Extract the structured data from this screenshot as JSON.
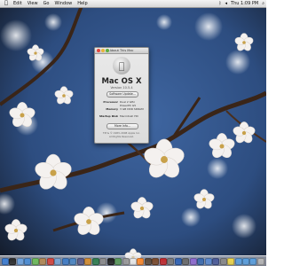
{
  "menubar": {
    "items": [
      "Edit",
      "View",
      "Go",
      "Window",
      "Help"
    ],
    "clock": "Thu 1:09 PM"
  },
  "about_window": {
    "title": "About This Mac",
    "os_name": "Mac OS X",
    "version": "Version 10.5.4",
    "software_update_label": "Software Update...",
    "rows": [
      {
        "label": "Processor",
        "value": "Dual 2 GHz PowerPC G5"
      },
      {
        "label": "Memory",
        "value": "3 GB DDR SDRAM"
      },
      {
        "label": "Startup Disk",
        "value": "Macintosh HD"
      }
    ],
    "more_info_label": "More Info...",
    "footer_line1": "TM & © 1983–2008 Apple Inc.",
    "footer_line2": "All Rights Reserved."
  },
  "colors": {
    "sky": "#2d4d80",
    "branch": "#3a2518",
    "blossom": "#f4f1ef",
    "blossom_center": "#c8a14a"
  },
  "dock": {
    "icons": [
      "finder-icon",
      "dashboard-icon",
      "mail-icon",
      "safari-icon",
      "ichat-icon",
      "address-book-icon",
      "ical-icon",
      "preview-icon",
      "itunes-icon",
      "iphoto-icon",
      "imovie-icon",
      "garageband-icon",
      "time-machine-icon",
      "system-preferences-icon",
      "terminal-icon",
      "activity-monitor-icon",
      "disk-utility-icon",
      "textedit-icon",
      "calculator-icon",
      "chess-icon",
      "dictionary-icon",
      "photo-booth-icon",
      "font-book-icon",
      "quicktime-icon",
      "image-capture-icon",
      "front-row-icon",
      "spaces-icon",
      "expose-icon",
      "grapher-icon",
      "console-icon",
      "stickies-icon",
      "downloads-icon",
      "documents-icon",
      "applications-icon",
      "trash-icon"
    ],
    "icon_colors": [
      "#3d7fd6",
      "#2b2b2b",
      "#6fa4e0",
      "#4a8ed8",
      "#6fbf5a",
      "#b58a55",
      "#d9453d",
      "#7aa6d6",
      "#3f7dc8",
      "#4b87c4",
      "#5c5c8a",
      "#d88f2f",
      "#2f7f4f",
      "#8c8c8c",
      "#222222",
      "#5a9a5a",
      "#9a9a9a",
      "#e7e7e7",
      "#ff8a2b",
      "#5c4a3a",
      "#7c4a2a",
      "#c4272b",
      "#7a7a7a",
      "#2f63b7",
      "#6a6a6a",
      "#8f6ad1",
      "#3b6bb0",
      "#5a8ad1",
      "#4a5a9a",
      "#8a8a8a",
      "#f0d84a",
      "#5aa0e0",
      "#5aa0e0",
      "#5aa0e0",
      "#b8b8b8"
    ]
  }
}
